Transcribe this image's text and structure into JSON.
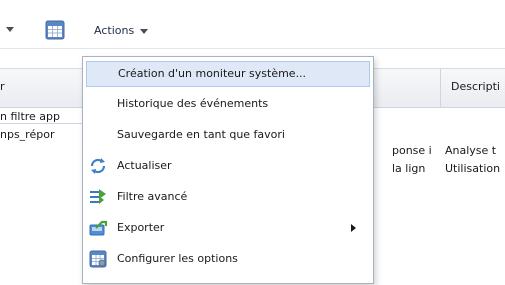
{
  "toolbar": {
    "actions_label": "Actions"
  },
  "table": {
    "header_left": "r",
    "header_right": "Descripti",
    "row_left": [
      "n filtre app",
      "nps_répor"
    ],
    "row_mid": [
      "ponse i",
      "la lign"
    ],
    "row_right": [
      "Analyse t",
      "Utilisation"
    ]
  },
  "menu": {
    "items": [
      {
        "label": "Création d'un moniteur système...",
        "icon": null,
        "highlighted": true
      },
      {
        "label": "Historique des événements",
        "icon": null
      },
      {
        "label": "Sauvegarde en tant que favori",
        "icon": null
      },
      {
        "label": "Actualiser",
        "icon": "refresh-icon"
      },
      {
        "label": "Filtre avancé",
        "icon": "advanced-filter-icon"
      },
      {
        "label": "Exporter",
        "icon": "export-icon",
        "submenu": true
      },
      {
        "label": "Configurer les options",
        "icon": "configure-options-icon"
      }
    ]
  },
  "colors": {
    "highlight_bg": "#dfe8f6",
    "highlight_border": "#aecbee",
    "menu_border": "#a8b3c0"
  }
}
